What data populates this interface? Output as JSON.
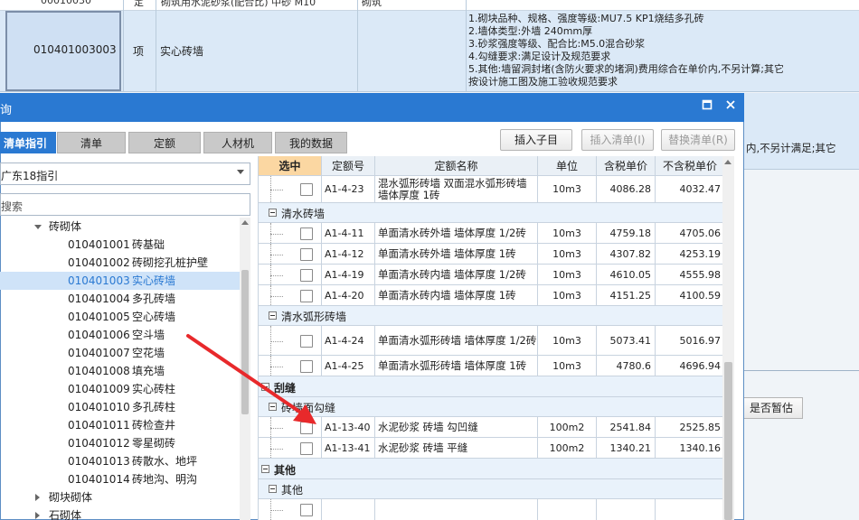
{
  "background": {
    "top_row_cut": [
      "00010030",
      "定",
      "砌筑用水泥砂浆(配合比) 中砂 M10",
      "砌筑"
    ],
    "row": {
      "code": "010401003003",
      "unit": "项",
      "name": "实心砖墙",
      "description": [
        "1.砌块品种、规格、强度等级:MU7.5 KP1烧结多孔砖",
        "2.墙体类型:外墙 240mm厚",
        "3.砂浆强度等级、配合比:M5.0混合砂浆",
        "4.勾缝要求:满足设计及规范要求",
        "5.其他:墙留洞封堵(含防火要求的堵洞)费用综合在单价内,不另计算;其它",
        "按设计施工图及施工验收规范要求"
      ],
      "right_fragment": "内,不另计满足;其它"
    },
    "zangu_label": "是否暂估"
  },
  "dialog": {
    "title": "询",
    "tabs": [
      "清单指引",
      "清单",
      "定额",
      "人材机",
      "我的数据"
    ],
    "active_tab": 0,
    "buttons": {
      "insert_child": "插入子目",
      "insert_list": "插入清单(I)",
      "replace_list": "替换清单(R)"
    },
    "combo_value": "广东18指引",
    "search_placeholder": "搜索",
    "tree": [
      {
        "label": "砖砌体",
        "level": 0,
        "expanded": true
      },
      {
        "code": "010401001",
        "name": "砖基础",
        "level": 1
      },
      {
        "code": "010401002",
        "name": "砖砌挖孔桩护壁",
        "level": 1
      },
      {
        "code": "010401003",
        "name": "实心砖墙",
        "level": 1,
        "selected": true
      },
      {
        "code": "010401004",
        "name": "多孔砖墙",
        "level": 1
      },
      {
        "code": "010401005",
        "name": "空心砖墙",
        "level": 1
      },
      {
        "code": "010401006",
        "name": "空斗墙",
        "level": 1
      },
      {
        "code": "010401007",
        "name": "空花墙",
        "level": 1
      },
      {
        "code": "010401008",
        "name": "填充墙",
        "level": 1
      },
      {
        "code": "010401009",
        "name": "实心砖柱",
        "level": 1
      },
      {
        "code": "010401010",
        "name": "多孔砖柱",
        "level": 1
      },
      {
        "code": "010401011",
        "name": "砖检查井",
        "level": 1
      },
      {
        "code": "010401012",
        "name": "零星砌砖",
        "level": 1
      },
      {
        "code": "010401013",
        "name": "砖散水、地坪",
        "level": 1
      },
      {
        "code": "010401014",
        "name": "砖地沟、明沟",
        "level": 1
      },
      {
        "label": "砌块砌体",
        "level": 0,
        "expanded": false
      },
      {
        "label": "石砌体",
        "level": 0,
        "expanded": false
      }
    ],
    "grid": {
      "headers": [
        "选中",
        "定额号",
        "定额名称",
        "单位",
        "含税单价",
        "不含税单价"
      ],
      "rows": [
        {
          "type": "item",
          "code": "A1-4-23",
          "name": "混水弧形砖墙 双面混水弧形砖墙 墙体厚度 1砖",
          "unit": "10m3",
          "price": "4086.28",
          "price_ex": "4032.47"
        },
        {
          "type": "group",
          "label": "清水砖墙"
        },
        {
          "type": "item",
          "code": "A1-4-11",
          "name": "单面清水砖外墙 墙体厚度 1/2砖",
          "unit": "10m3",
          "price": "4759.18",
          "price_ex": "4705.06"
        },
        {
          "type": "item",
          "code": "A1-4-12",
          "name": "单面清水砖外墙 墙体厚度 1砖",
          "unit": "10m3",
          "price": "4307.82",
          "price_ex": "4253.19"
        },
        {
          "type": "item",
          "code": "A1-4-19",
          "name": "单面清水砖内墙 墙体厚度 1/2砖",
          "unit": "10m3",
          "price": "4610.05",
          "price_ex": "4555.98"
        },
        {
          "type": "item",
          "code": "A1-4-20",
          "name": "单面清水砖内墙 墙体厚度 1砖",
          "unit": "10m3",
          "price": "4151.25",
          "price_ex": "4100.59"
        },
        {
          "type": "group",
          "label": "清水弧形砖墙"
        },
        {
          "type": "item",
          "code": "A1-4-24",
          "name": "单面清水弧形砖墙 墙体厚度 1/2砖",
          "unit": "10m3",
          "price": "5073.41",
          "price_ex": "5016.97"
        },
        {
          "type": "item",
          "code": "A1-4-25",
          "name": "单面清水弧形砖墙 墙体厚度 1砖",
          "unit": "10m3",
          "price": "4780.6",
          "price_ex": "4696.94"
        },
        {
          "type": "topgroup",
          "label": "刮缝"
        },
        {
          "type": "group",
          "label": "砖墙面勾缝"
        },
        {
          "type": "item",
          "code": "A1-13-40",
          "name": "水泥砂浆 砖墙 勾凹缝",
          "unit": "100m2",
          "price": "2541.84",
          "price_ex": "2525.85"
        },
        {
          "type": "item",
          "code": "A1-13-41",
          "name": "水泥砂浆 砖墙 平缝",
          "unit": "100m2",
          "price": "1340.21",
          "price_ex": "1340.16"
        },
        {
          "type": "topgroup",
          "label": "其他"
        },
        {
          "type": "group",
          "label": "其他"
        },
        {
          "type": "item",
          "code": "",
          "name": "",
          "unit": "",
          "price": "",
          "price_ex": ""
        }
      ]
    }
  },
  "colors": {
    "title_bar": "#2a79d2",
    "selected_header": "#fbd7a2",
    "annotation_arrow": "#e8292b"
  }
}
